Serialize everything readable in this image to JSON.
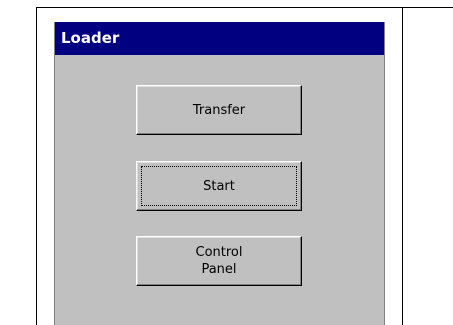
{
  "window": {
    "title": "Loader"
  },
  "buttons": {
    "transfer": "Transfer",
    "start": "Start",
    "control_panel": "Control\nPanel"
  },
  "colors": {
    "titlebar": "#000080",
    "window_bg": "#c0c0c0",
    "title_text": "#ffffff"
  }
}
